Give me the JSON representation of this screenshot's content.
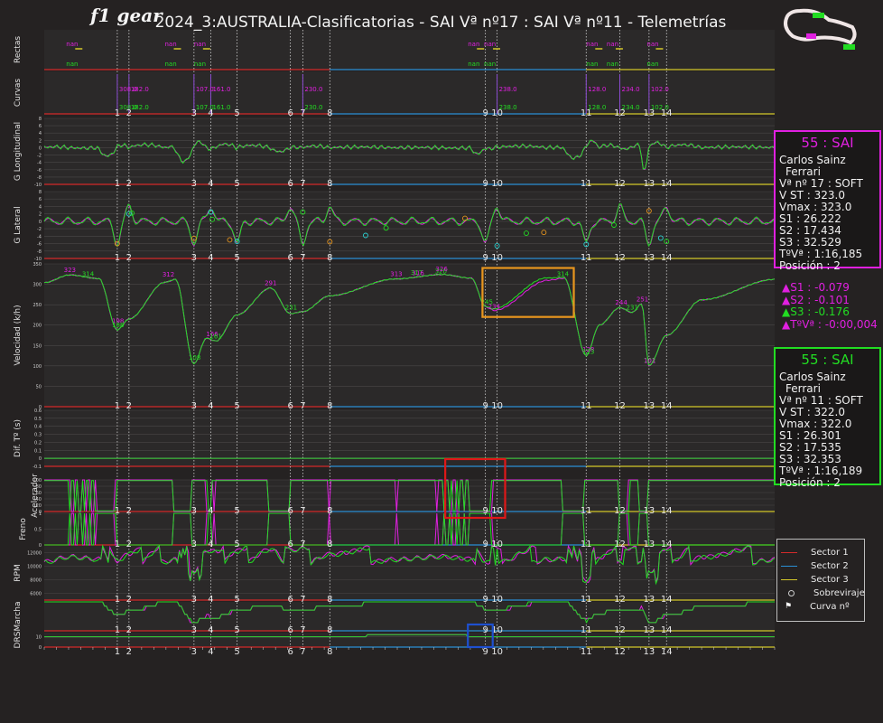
{
  "title": "2024_3:AUSTRALIA-Clasificatorias - SAI Vª nº17 : SAI Vª nº11 - Telemetrías",
  "logo_text": "f1 gear",
  "colors": {
    "lap_a": "#e020e0",
    "lap_b": "#22dd22",
    "sector1": "#d42a2a",
    "sector2": "#2a8fd4",
    "sector3": "#d4c82a",
    "highlight_orange": "#e8961e",
    "highlight_red": "#e01818",
    "highlight_blue": "#1e50d0"
  },
  "corner_labels": [
    "1",
    "2",
    "3",
    "4",
    "5",
    "6",
    "7",
    "8",
    "9",
    "10",
    "11",
    "12",
    "13",
    "14"
  ],
  "driver_box_a": {
    "header": "55 : SAI",
    "name": "Carlos Sainz",
    "team": "Ferrari",
    "lap": "Vª nº 17 : SOFT",
    "vst": "V ST : 323.0",
    "vmax": "Vmax : 323.0",
    "s1": "S1 : 26.222",
    "s2": "S2 : 17.434",
    "s3": "S3 : 32.529",
    "laptime": "TºVª : 1:16,185",
    "position": "Posición : 2"
  },
  "deltas": {
    "s1": "▲S1 : -0.079",
    "s2": "▲S2 : -0.101",
    "s3": "▲S3 : -0.176",
    "lap": "▲TºVª : -0:00,004"
  },
  "driver_box_b": {
    "header": "55 : SAI",
    "name": "Carlos Sainz",
    "team": "Ferrari",
    "lap": "Vª nº 11 : SOFT",
    "vst": "V ST : 322.0",
    "vmax": "Vmax : 322.0",
    "s1": "S1 : 26.301",
    "s2": "S2 : 17.535",
    "s3": "S3 : 32.353",
    "laptime": "TºVª : 1:16,189",
    "position": "Posición : 2"
  },
  "legend": {
    "sector1": "Sector 1",
    "sector2": "Sector 2",
    "sector3": "Sector 3",
    "oversteer": "Sobreviraje",
    "corner": "Curva nº"
  },
  "chart_data": {
    "type": "line",
    "x_domain": [
      0,
      1
    ],
    "panels": [
      {
        "id": "rectas",
        "ylabel": "Rectas"
      },
      {
        "id": "curvas",
        "ylabel": "Curvas"
      },
      {
        "id": "glong",
        "ylabel": "G Longitudinal",
        "ylim": [
          -10,
          8
        ],
        "yticks": [
          -10,
          -8,
          -6,
          -4,
          -2,
          0,
          2,
          4,
          6,
          8
        ]
      },
      {
        "id": "glat",
        "ylabel": "G Lateral",
        "ylim": [
          -10,
          8
        ],
        "yticks": [
          -10,
          -8,
          -6,
          -4,
          -2,
          0,
          2,
          4,
          6,
          8
        ]
      },
      {
        "id": "speed",
        "ylabel": "Velocidad (k/h)",
        "ylim": [
          0,
          350
        ],
        "yticks": [
          0,
          50,
          100,
          150,
          200,
          250,
          300,
          350
        ]
      },
      {
        "id": "diff",
        "ylabel": "Dif. Tº (s)",
        "ylim": [
          -0.1,
          0.6
        ],
        "yticks": [
          -0.1,
          0.0,
          0.1,
          0.2,
          0.3,
          0.4,
          0.5,
          0.6
        ]
      },
      {
        "id": "throttle",
        "ylabel": "Acelerador",
        "ylim": [
          0,
          100
        ],
        "yticks": [
          0,
          20,
          40,
          60,
          80,
          100
        ]
      },
      {
        "id": "brake",
        "ylabel": "Freno",
        "ylim": [
          0,
          1
        ],
        "yticks": [
          0.0,
          0.5,
          1.0
        ]
      },
      {
        "id": "rpm",
        "ylabel": "RPM",
        "ylim": [
          5000,
          13000
        ],
        "yticks": [
          6000,
          8000,
          10000,
          12000
        ]
      },
      {
        "id": "gear",
        "ylabel": "Marcha",
        "ylim": [
          1,
          8
        ]
      },
      {
        "id": "drs",
        "ylabel": "DRS",
        "ylim": [
          0,
          14
        ],
        "yticks": [
          0,
          10
        ]
      }
    ],
    "corners": [
      {
        "n": "1",
        "x": 0.1
      },
      {
        "n": "2",
        "x": 0.116
      },
      {
        "n": "3",
        "x": 0.205
      },
      {
        "n": "4",
        "x": 0.228
      },
      {
        "n": "5",
        "x": 0.264
      },
      {
        "n": "6",
        "x": 0.337
      },
      {
        "n": "7",
        "x": 0.354
      },
      {
        "n": "8",
        "x": 0.391
      },
      {
        "n": "9",
        "x": 0.604
      },
      {
        "n": "10",
        "x": 0.62
      },
      {
        "n": "11",
        "x": 0.742
      },
      {
        "n": "12",
        "x": 0.788
      },
      {
        "n": "13",
        "x": 0.828
      },
      {
        "n": "14",
        "x": 0.852
      }
    ],
    "curve_speed_labels": [
      {
        "x": 0.1,
        "a": "308.0",
        "b": "308.0"
      },
      {
        "x": 0.116,
        "a": "182.0",
        "b": "182.0"
      },
      {
        "x": 0.205,
        "a": "107.0",
        "b": "107.0"
      },
      {
        "x": 0.228,
        "a": "161.0",
        "b": "161.0"
      },
      {
        "x": 0.354,
        "a": "230.0",
        "b": "230.0"
      },
      {
        "x": 0.62,
        "a": "238.0",
        "b": "238.0"
      },
      {
        "x": 0.742,
        "a": "128.0",
        "b": "128.0"
      },
      {
        "x": 0.788,
        "a": "234.0",
        "b": "234.0"
      },
      {
        "x": 0.828,
        "a": "102.0",
        "b": "102.0"
      }
    ],
    "rectas_labels": [
      "nan",
      "nan",
      "nan",
      "nan",
      "nan",
      "nan",
      "nan",
      "nan"
    ],
    "speed_annotations": [
      {
        "x": 0.035,
        "v": 323
      },
      {
        "x": 0.06,
        "v": 314
      },
      {
        "x": 0.101,
        "v": 198
      },
      {
        "x": 0.101,
        "v": 188
      },
      {
        "x": 0.17,
        "v": 312
      },
      {
        "x": 0.206,
        "v": 108
      },
      {
        "x": 0.23,
        "v": 166
      },
      {
        "x": 0.235,
        "v": 161
      },
      {
        "x": 0.31,
        "v": 291
      },
      {
        "x": 0.338,
        "v": 231
      },
      {
        "x": 0.482,
        "v": 313
      },
      {
        "x": 0.51,
        "v": 317
      },
      {
        "x": 0.512,
        "v": 316
      },
      {
        "x": 0.543,
        "v": 320
      },
      {
        "x": 0.544,
        "v": 326
      },
      {
        "x": 0.606,
        "v": 245
      },
      {
        "x": 0.616,
        "v": 234
      },
      {
        "x": 0.71,
        "v": 314
      },
      {
        "x": 0.745,
        "v": 128
      },
      {
        "x": 0.745,
        "v": 123
      },
      {
        "x": 0.79,
        "v": 244
      },
      {
        "x": 0.805,
        "v": 231
      },
      {
        "x": 0.819,
        "v": 251
      },
      {
        "x": 0.829,
        "v": 102
      },
      {
        "x": 0.829,
        "v": 101
      }
    ],
    "speed_keyframes": [
      [
        0.0,
        304
      ],
      [
        0.035,
        323
      ],
      [
        0.075,
        314
      ],
      [
        0.1,
        188
      ],
      [
        0.116,
        215
      ],
      [
        0.165,
        305
      ],
      [
        0.18,
        312
      ],
      [
        0.205,
        105
      ],
      [
        0.222,
        168
      ],
      [
        0.235,
        161
      ],
      [
        0.264,
        225
      ],
      [
        0.31,
        291
      ],
      [
        0.337,
        228
      ],
      [
        0.354,
        233
      ],
      [
        0.391,
        272
      ],
      [
        0.48,
        313
      ],
      [
        0.545,
        324
      ],
      [
        0.585,
        315
      ],
      [
        0.604,
        245
      ],
      [
        0.616,
        236
      ],
      [
        0.69,
        310
      ],
      [
        0.712,
        315
      ],
      [
        0.742,
        125
      ],
      [
        0.76,
        200
      ],
      [
        0.788,
        243
      ],
      [
        0.805,
        231
      ],
      [
        0.818,
        252
      ],
      [
        0.828,
        101
      ],
      [
        0.852,
        175
      ],
      [
        0.9,
        262
      ],
      [
        1.0,
        312
      ]
    ],
    "oversteer_points_glat": [
      [
        0.1,
        -6
      ],
      [
        0.116,
        2
      ],
      [
        0.12,
        2.2
      ],
      [
        0.205,
        -4.6
      ],
      [
        0.228,
        2.5
      ],
      [
        0.23,
        0.5
      ],
      [
        0.254,
        -5
      ],
      [
        0.264,
        -5.4
      ],
      [
        0.354,
        2.5
      ],
      [
        0.391,
        -5.5
      ],
      [
        0.44,
        -3.8
      ],
      [
        0.468,
        -1.8
      ],
      [
        0.576,
        0.8
      ],
      [
        0.62,
        -6.6
      ],
      [
        0.66,
        -3.2
      ],
      [
        0.684,
        -3.0
      ],
      [
        0.742,
        -6.2
      ],
      [
        0.78,
        -1
      ],
      [
        0.828,
        2.8
      ],
      [
        0.844,
        -4.5
      ],
      [
        0.852,
        -5.4
      ]
    ],
    "highlights": [
      {
        "panel": "speed",
        "x0": 0.6,
        "x1": 0.725,
        "y0": 220,
        "y1": 340,
        "color": "orange"
      },
      {
        "panel": "throttle_brake",
        "x0": 0.549,
        "x1": 0.631,
        "color": "red"
      },
      {
        "panel": "drs",
        "x0": 0.58,
        "x1": 0.614,
        "color": "blue"
      }
    ],
    "sector_boundaries": [
      0.0,
      0.391,
      0.742,
      1.0
    ]
  }
}
